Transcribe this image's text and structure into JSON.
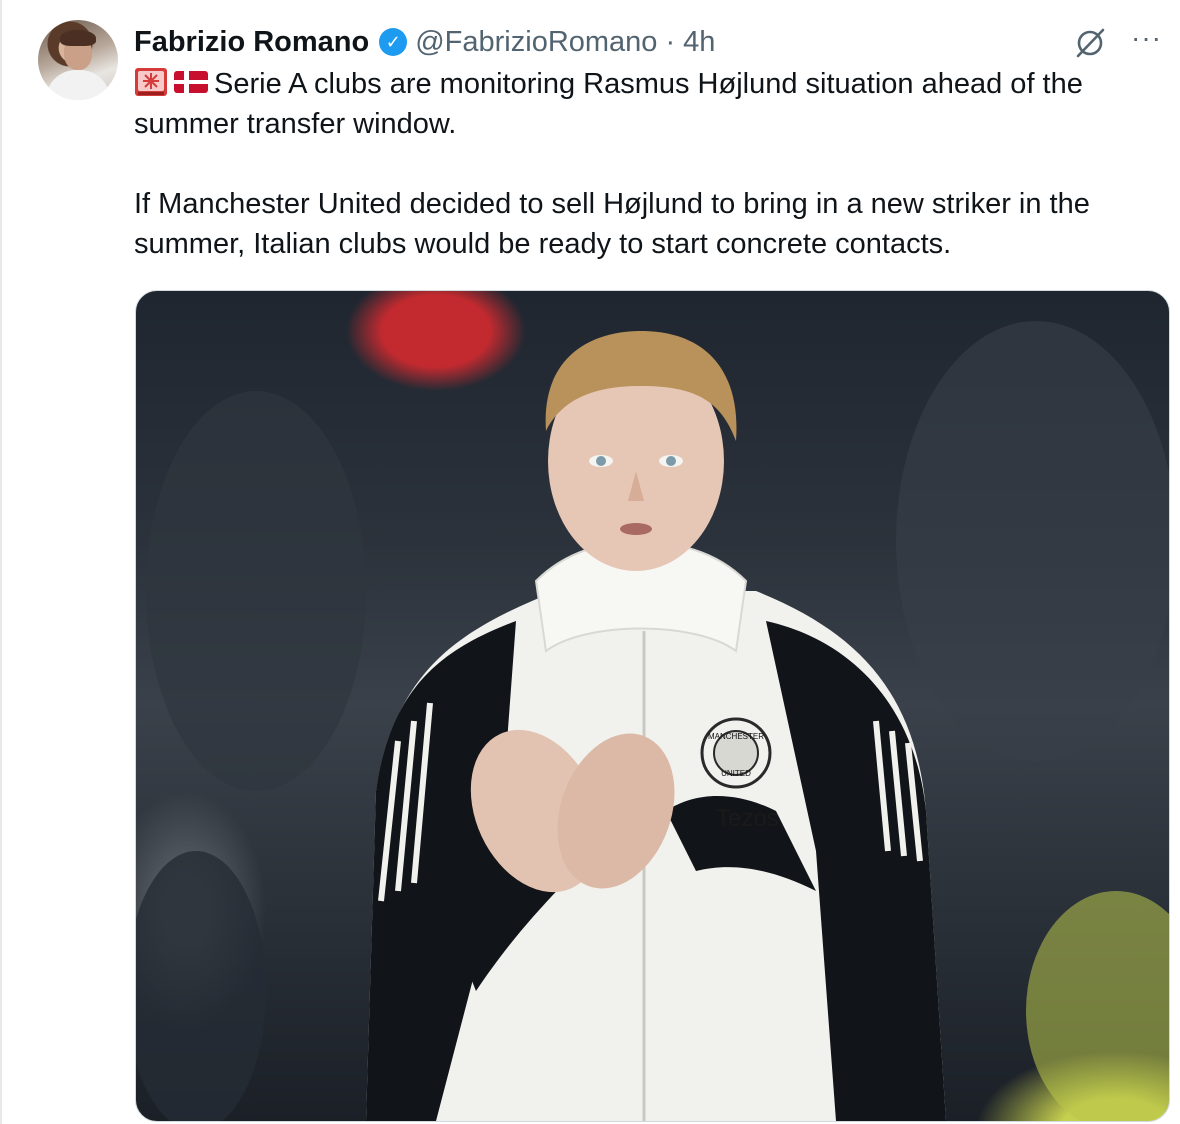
{
  "tweet": {
    "author_name": "Fabrizio Romano",
    "verified_badge": "✓",
    "handle": "@FabrizioRomano",
    "separator": "·",
    "time_ago": "4h",
    "more_label": "···",
    "paragraph_1": "Serie A clubs are monitoring Rasmus Højlund situation ahead of the summer transfer window.",
    "paragraph_2": "If Manchester United decided to sell Højlund to bring in a new striker in the summer, Italian clubs would be ready to start concrete contacts."
  },
  "photo": {
    "crest_top": "MANCHESTER",
    "crest_bottom": "UNITED",
    "sponsor": "Tezos"
  },
  "icons": {
    "emoji_1": "rotating-light-icon",
    "emoji_2": "denmark-flag-icon",
    "grok": "grok-icon",
    "more": "more-icon"
  },
  "colors": {
    "verified": "#1d9bf0",
    "secondary_text": "#536471",
    "jacket_black": "#111418",
    "jacket_white": "#f1f1ee"
  }
}
